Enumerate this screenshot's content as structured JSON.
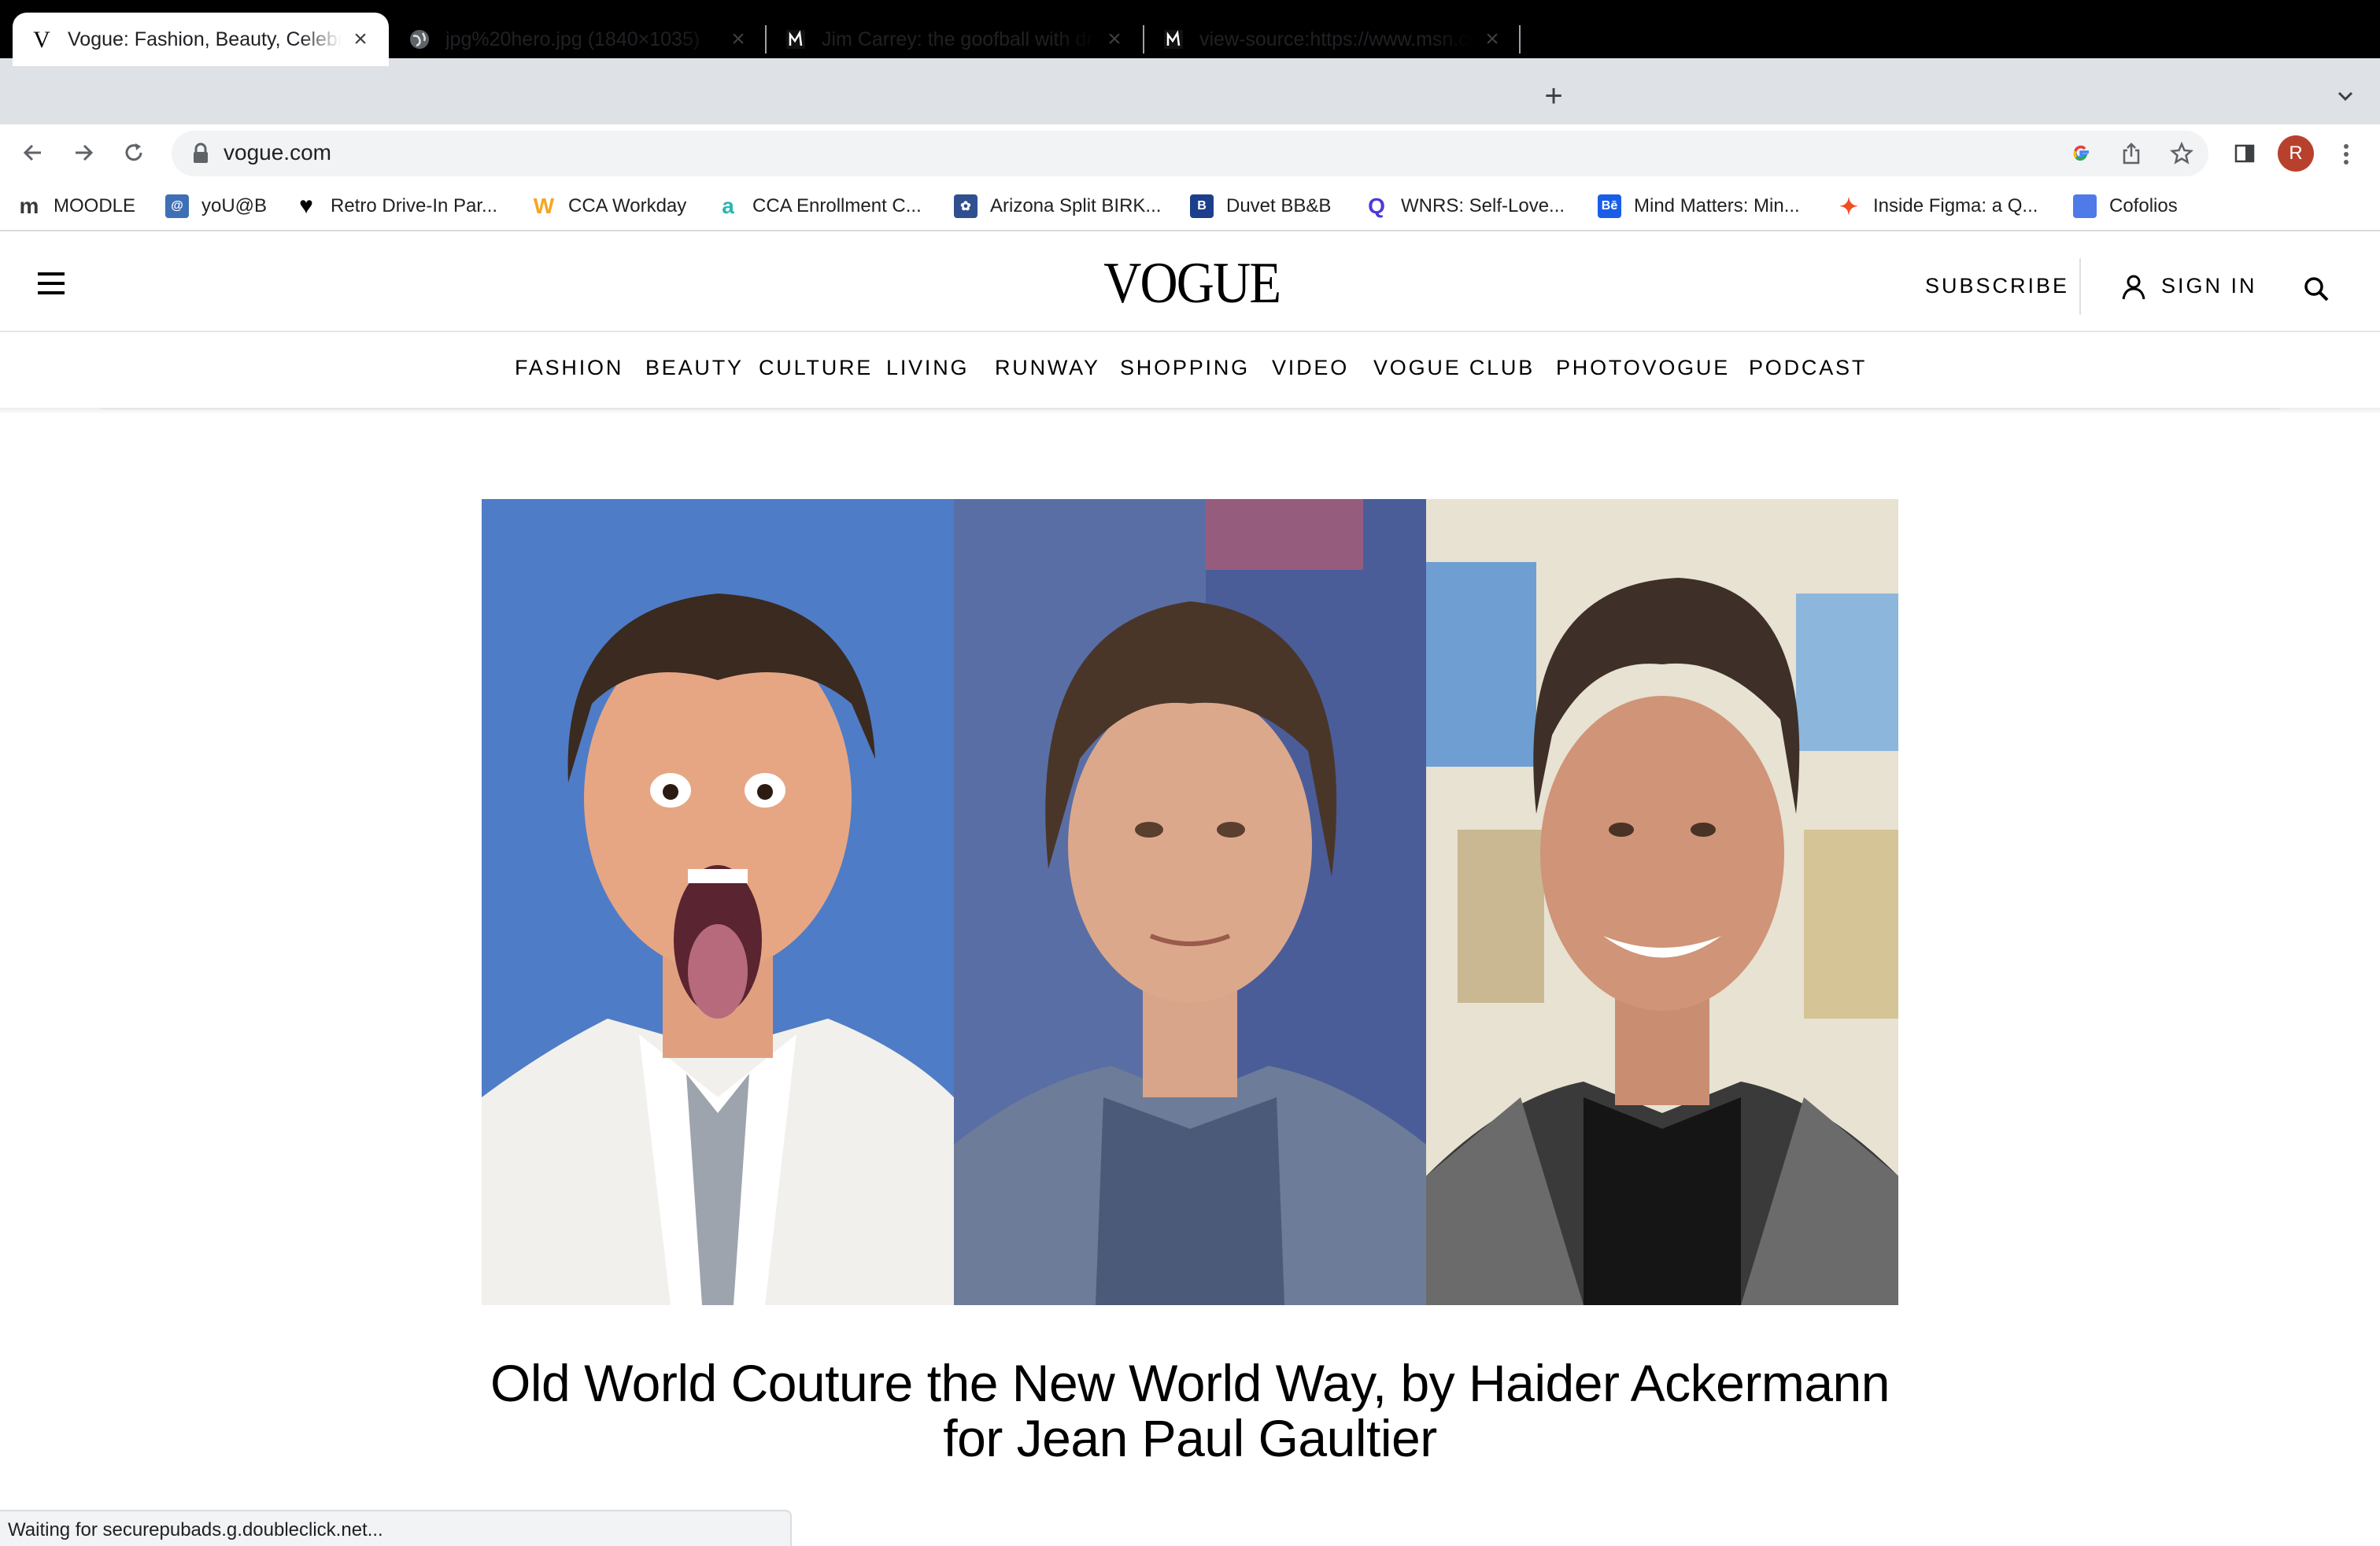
{
  "browser": {
    "tabs": [
      {
        "title": "Vogue: Fashion, Beauty, Celebrity",
        "favicon": "vogue-v-icon",
        "active": true
      },
      {
        "title": "jpg%20hero.jpg (1840×1035)",
        "favicon": "globe-icon",
        "active": false
      },
      {
        "title": "Jim Carrey: the goofball with dramatic",
        "favicon": "msn-icon",
        "active": false
      },
      {
        "title": "view-source:https://www.msn.com",
        "favicon": "msn-icon",
        "active": false
      }
    ],
    "close_glyph": "×",
    "new_tab_glyph": "+",
    "url": "vogue.com",
    "profile_initial": "R",
    "status_text": "Waiting for securepubads.g.doubleclick.net..."
  },
  "bookmarks": [
    {
      "label": "MOODLE",
      "icon": "moodle-icon",
      "glyph": "m",
      "color": "#3a3a3a"
    },
    {
      "label": "yoU@B",
      "icon": "youb-icon",
      "glyph": "@",
      "color": "#3f6fb5"
    },
    {
      "label": "Retro Drive-In Par...",
      "icon": "heart-icon",
      "glyph": "♥",
      "color": "#000000"
    },
    {
      "label": "CCA Workday",
      "icon": "workday-icon",
      "glyph": "W",
      "color": "#f5a623"
    },
    {
      "label": "CCA Enrollment C...",
      "icon": "enrollment-icon",
      "glyph": "a",
      "color": "#2ab6b0"
    },
    {
      "label": "Arizona Split BIRK...",
      "icon": "birkenstock-icon",
      "glyph": "✿",
      "color": "#2f4f8f"
    },
    {
      "label": "Duvet BB&B",
      "icon": "bbb-icon",
      "glyph": "B",
      "color": "#1c3f8c"
    },
    {
      "label": "WNRS: Self-Love...",
      "icon": "wnrs-icon",
      "glyph": "Q",
      "color": "#4a3ad8"
    },
    {
      "label": "Mind Matters: Min...",
      "icon": "behance-icon",
      "glyph": "Bē",
      "color": "#1a5ee8"
    },
    {
      "label": "Inside Figma: a Q...",
      "icon": "figma-icon",
      "glyph": "✦",
      "color": "#f24e1e"
    },
    {
      "label": "Cofolios",
      "icon": "docs-icon",
      "glyph": "",
      "color": "#4f7be8"
    }
  ],
  "site": {
    "logo": "VOGUE",
    "subscribe": "SUBSCRIBE",
    "sign_in": "SIGN IN",
    "nav": [
      "FASHION",
      "BEAUTY",
      "CULTURE",
      "LIVING",
      "RUNWAY",
      "SHOPPING",
      "VIDEO",
      "VOGUE CLUB",
      "PHOTOVOGUE",
      "PODCAST"
    ],
    "headline": "Old World Couture the New World Way, by Haider Ackermann for Jean Paul Gaultier"
  },
  "colors": {
    "tab_strip": "#dee1e6",
    "avatar": "#b8412d",
    "hero_bg_left": "#4a78c8",
    "hero_bg_right": "#e8e4d8"
  }
}
